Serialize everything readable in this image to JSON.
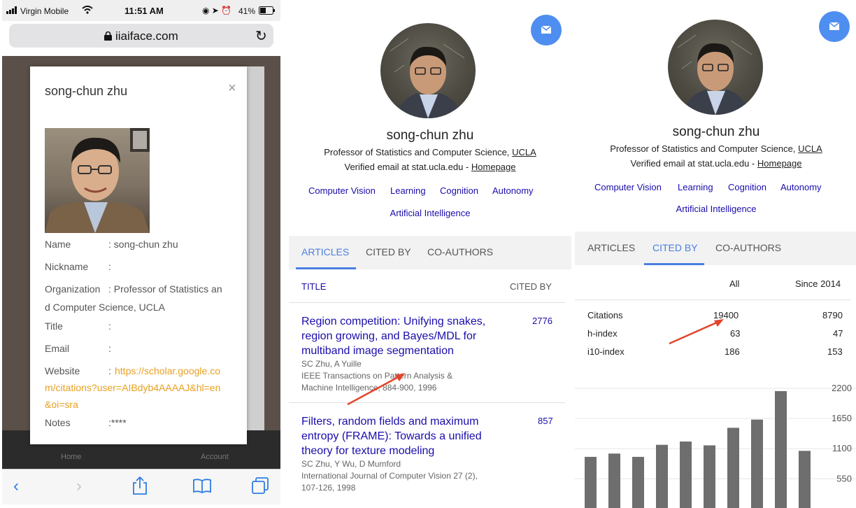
{
  "mobile": {
    "status": {
      "carrier": "Virgin Mobile",
      "time": "11:51 AM",
      "battery": "41%"
    },
    "url": "iiaiface.com",
    "modal": {
      "title": "song-chun zhu",
      "fields": [
        {
          "label": "Name",
          "value": ": song-chun zhu"
        },
        {
          "label": "Nickname",
          "value": ":"
        },
        {
          "label": "Organization",
          "value": ": Professor of Statistics an"
        },
        {
          "label": "",
          "value": "d Computer Science,   UCLA"
        },
        {
          "label": "Title",
          "value": ":"
        },
        {
          "label": "Email",
          "value": ":"
        },
        {
          "label": "Website",
          "value": ":"
        },
        {
          "label": "Notes",
          "value": ":****"
        }
      ],
      "website_lines": [
        "https://scholar.google.co",
        "m/citations?user=AIBdyb4AAAAJ&hl=en",
        "&oi=sra"
      ]
    },
    "bg_labels": {
      "home": "Home",
      "account": "Account"
    }
  },
  "profile": {
    "name": "song-chun zhu",
    "affiliation_prefix": "Professor of Statistics and Computer Science,",
    "affiliation_link": "UCLA",
    "email_prefix": "Verified email at stat.ucla.edu -",
    "homepage": "Homepage",
    "tags": [
      "Computer Vision",
      "Learning",
      "Cognition",
      "Autonomy",
      "Artificial Intelligence"
    ],
    "tabs": [
      "ARTICLES",
      "CITED BY",
      "CO-AUTHORS"
    ]
  },
  "articles": {
    "header_title": "TITLE",
    "header_cited": "CITED BY",
    "items": [
      {
        "title_lines": [
          "Region competition: Unifying snakes,",
          "region growing, and Bayes/MDL for",
          "multiband image segmentation"
        ],
        "authors": "SC Zhu, A Yuille",
        "venue_lines": [
          "IEEE Transactions on Pattern Analysis &",
          "Machine Intelligence, 884-900, 1996"
        ],
        "cited": "2776"
      },
      {
        "title_lines": [
          "Filters, random fields and maximum",
          "entropy (FRAME): Towards a unified",
          "theory for texture modeling"
        ],
        "authors": "SC Zhu, Y Wu, D Mumford",
        "venue_lines": [
          "International Journal of Computer Vision 27 (2),",
          "107-126, 1998"
        ],
        "cited": "857"
      }
    ]
  },
  "cited_by": {
    "col_all": "All",
    "col_since": "Since 2014",
    "rows": [
      {
        "label": "Citations",
        "all": "19400",
        "since": "8790"
      },
      {
        "label": "h-index",
        "all": "63",
        "since": "47"
      },
      {
        "label": "i10-index",
        "all": "186",
        "since": "153"
      }
    ]
  },
  "chart_data": {
    "type": "bar",
    "title": "",
    "xlabel": "",
    "ylabel": "",
    "y_ticks": [
      2200,
      1650,
      1100,
      550
    ],
    "ylim": [
      400,
      2200
    ],
    "values": [
      950,
      1010,
      950,
      1170,
      1230,
      1160,
      1480,
      1630,
      2150,
      1060
    ],
    "bar_color": "#6e6e6e"
  },
  "colors": {
    "accent_blue": "#4a7fe0",
    "link_blue": "#1a0dab",
    "website_orange": "#e8a020",
    "arrow_red": "#e2452c",
    "mail_button": "#4e8ef0"
  }
}
